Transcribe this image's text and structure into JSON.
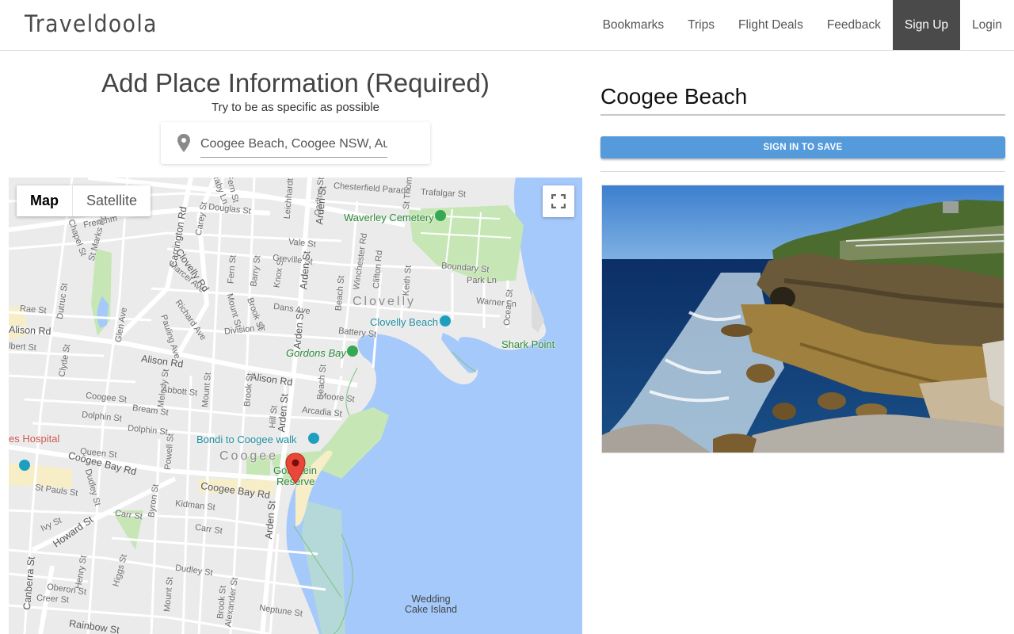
{
  "navbar": {
    "brand": "Traveldoola",
    "items": [
      {
        "label": "Bookmarks",
        "active": false
      },
      {
        "label": "Trips",
        "active": false
      },
      {
        "label": "Flight Deals",
        "active": false
      },
      {
        "label": "Feedback",
        "active": false
      },
      {
        "label": "Sign Up",
        "active": true
      },
      {
        "label": "Login",
        "active": false
      }
    ]
  },
  "form": {
    "title": "Add Place Information (Required)",
    "subtitle": "Try to be as specific as possible",
    "location_value": "Coogee Beach, Coogee NSW, Au",
    "location_icon": "map-pin-icon"
  },
  "map": {
    "type_buttons": [
      {
        "label": "Map",
        "active": true
      },
      {
        "label": "Satellite",
        "active": false
      }
    ],
    "fullscreen_icon": "fullscreen-icon",
    "marker_icon": "map-marker-icon",
    "labels": {
      "waverley_cemetery": "Waverley Cemetery",
      "clovelly": "Clovelly",
      "clovelly_beach": "Clovelly Beach",
      "shark_point": "Shark Point",
      "gordons_bay": "Gordons Bay",
      "bondi_to_coogee_walk": "Bondi to Coogee walk",
      "coogee": "Coogee",
      "goldstein_reserve_1": "Goldstein",
      "goldstein_reserve_2": "Reserve",
      "hospital": "es Hospital",
      "wedding_cake_1": "Wedding",
      "wedding_cake_2": "Cake Island",
      "chesterfield_parade": "Chesterfield Parade",
      "trafalgar_st": "Trafalgar St",
      "st_thomas_st": "St Thomas",
      "boundary_st": "Boundary St",
      "park_ln": "Park Ln",
      "warner_ln": "Warner Ln",
      "ocean_st": "Ocean St",
      "battery_st": "Battery St",
      "dans_ave": "Dans Ave",
      "division_st": "Division St",
      "alison_rd_1": "Alison Rd",
      "alison_rd_2": "Alison Rd",
      "alison_rd_3": "Alison Rd",
      "moore_st": "Moore St",
      "arcadia_st": "Arcadia St",
      "beach_st_1": "Beach St",
      "beach_st_2": "Beach St",
      "arden_st_1": "Arden St",
      "arden_st_2": "Arden St",
      "arden_st_3": "Arden St",
      "arden_st_4": "Arden St",
      "arden_st_5": "Arden St",
      "coogee_bay_rd_1": "Coogee Bay Rd",
      "coogee_bay_rd_2": "Coogee Bay Rd",
      "queen_st": "Queen St",
      "st_pauls_st": "St Pauls St",
      "dudley_st_1": "Dudley St",
      "dudley_st_2": "Dudley St",
      "carr_st_1": "Carr St",
      "carr_st_2": "Carr St",
      "howard_st": "Howard St",
      "ivy_st": "Ivy St",
      "canberra_st": "Canberra St",
      "henry_st": "Henry St",
      "higgs_st": "Higgs St",
      "oberon_st": "Oberon St",
      "creer_st": "Creer St",
      "rainbow_st": "Rainbow St",
      "mount_st_1": "Mount St",
      "mount_st_2": "Mount St",
      "mount_st_3": "Mount St",
      "brook_st_1": "Brook St",
      "brook_st_2": "Brook St",
      "brook_st_3": "Brook St",
      "alexander_st": "Alexander St",
      "neptune_st": "Neptune St",
      "byron_st": "Byron St",
      "kidman_st": "Kidman St",
      "melody_st": "Melody St",
      "abbott_st": "Abbott St",
      "bream_st": "Bream St",
      "coogee_st": "Coogee St",
      "dolphin_st_1": "Dolphin St",
      "dolphin_st_2": "Dolphin St",
      "clyde_st": "Clyde St",
      "glen_ave": "Glen Ave",
      "dutruc_st": "Dutruc St",
      "rae_st": "Rae St",
      "albert_st": "lbert St",
      "pauling_ave": "Pauling Ave",
      "richard_ave": "Richard Ave",
      "marcel_ave": "Marcel Ave",
      "carrington_rd": "Carrington Rd",
      "clovelly_rd": "Clovelly Rd",
      "carey_st": "Carey St",
      "douglas_st": "Douglas St",
      "fern_st_1": "Fern St",
      "fern_st_2": "Fern St",
      "barry_st": "Barry St",
      "knox_st": "Knox St",
      "greville_st": "Greville St",
      "vale_st": "Vale St",
      "winchester_rd": "Winchester Rd",
      "clifton_rd": "Clifton Rd",
      "keith_st": "Keith St",
      "leichhardt_st": "Leichhardt St",
      "carlton_st": "Carlton St",
      "raby_ln": "Raby Ln",
      "chapel_st": "Chapel St",
      "st_marks_rd": "St Marks Rd",
      "frenchmans": "Frenchm",
      "hill_st": "Hill St",
      "powell_st": "Powell St"
    }
  },
  "place": {
    "name": "Coogee Beach",
    "save_button": "SIGN IN TO SAVE",
    "photo_alt": "Rocky coastline cliffs beside the ocean"
  },
  "colors": {
    "nav_active_bg": "#4a4a4a",
    "save_button_bg": "#559bdb",
    "map_water": "#a5c9fb",
    "map_land": "#ebebeb",
    "map_park": "#c6e7b5",
    "map_beach": "#f7eec8",
    "marker_red": "#e9473a"
  }
}
